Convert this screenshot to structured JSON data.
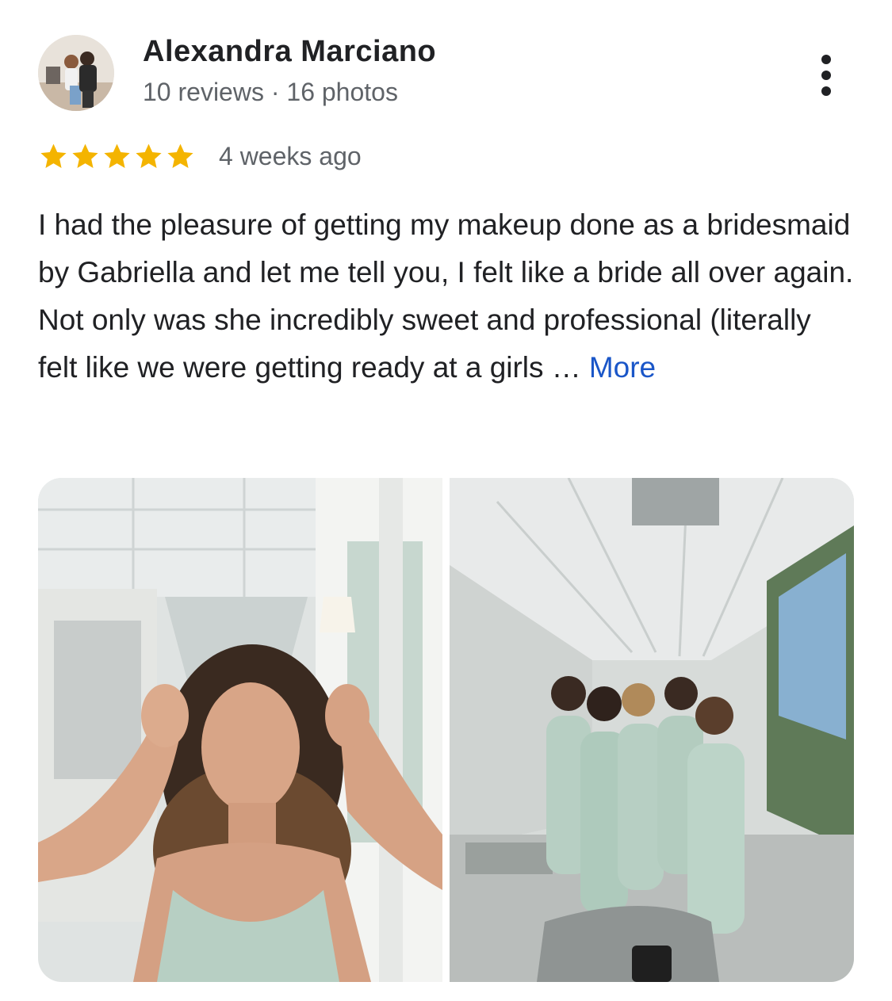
{
  "reviewer": {
    "name": "Alexandra Marciano",
    "meta": "10 reviews · 16 photos",
    "avatar_icon": "profile-photo"
  },
  "rating": {
    "stars": 5,
    "max": 5,
    "time": "4 weeks ago",
    "star_color": "#f4b400"
  },
  "review": {
    "text": "I had the pleasure of getting my makeup done as a bridesmaid by Gabriella and let me tell you, I felt like a bride all over again. Not only was she incredibly sweet and professional (literally felt like we were getting ready at a girls …",
    "more_label": "More"
  },
  "photos": [
    {
      "icon": "selfie-photo"
    },
    {
      "icon": "bridesmaids-group-photo"
    }
  ],
  "menu_icon": "more-vert-icon",
  "colors": {
    "link": "#1a56c8",
    "dress": "#b7cfc3"
  }
}
